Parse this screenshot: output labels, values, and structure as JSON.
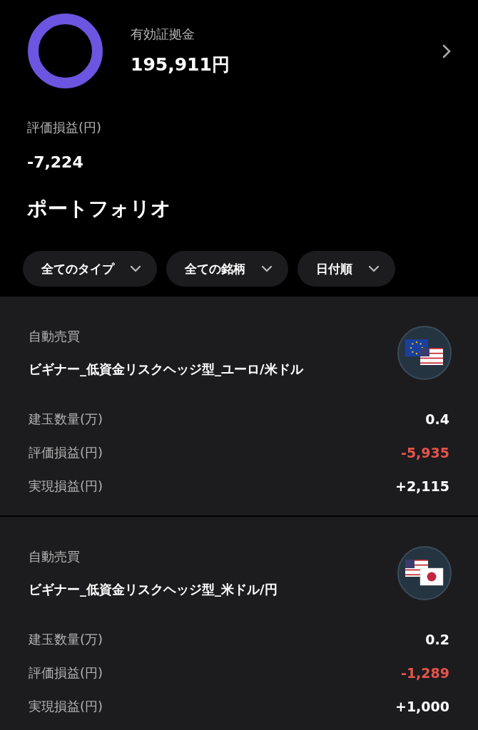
{
  "summary": {
    "margin_label": "有効証拠金",
    "margin_value": "195,911円",
    "pl_label": "評価損益(円)",
    "pl_value": "-7,224"
  },
  "section_title": "ポートフォリオ",
  "filters": [
    {
      "label": "全てのタイプ"
    },
    {
      "label": "全ての銘柄"
    },
    {
      "label": "日付順"
    }
  ],
  "positions": [
    {
      "type": "自動売買",
      "name": "ビギナー_低資金リスクヘッジ型_ユーロ/米ドル",
      "flags": [
        {
          "kind": "eu"
        },
        {
          "kind": "us"
        }
      ],
      "rows": [
        {
          "label": "建玉数量(万)",
          "value": "0.4",
          "negative": false
        },
        {
          "label": "評価損益(円)",
          "value": "-5,935",
          "negative": true
        },
        {
          "label": "実現損益(円)",
          "value": "+2,115",
          "negative": false
        }
      ]
    },
    {
      "type": "自動売買",
      "name": "ビギナー_低資金リスクヘッジ型_米ドル/円",
      "flags": [
        {
          "kind": "us"
        },
        {
          "kind": "jp"
        }
      ],
      "rows": [
        {
          "label": "建玉数量(万)",
          "value": "0.2",
          "negative": false
        },
        {
          "label": "評価損益(円)",
          "value": "-1,289",
          "negative": true
        },
        {
          "label": "実現損益(円)",
          "value": "+1,000",
          "negative": false
        }
      ]
    }
  ]
}
